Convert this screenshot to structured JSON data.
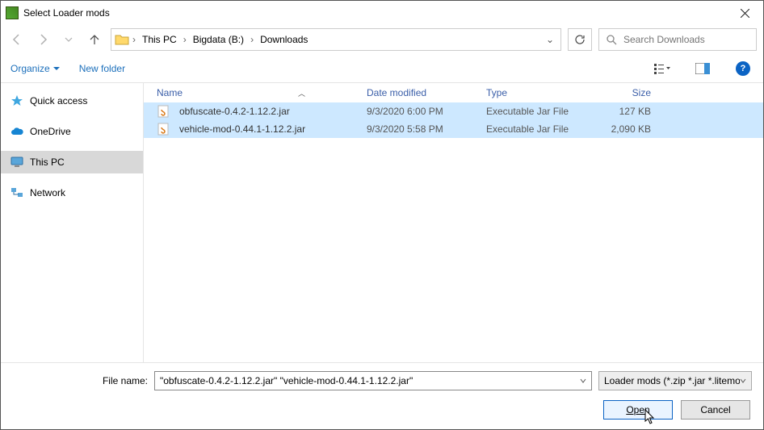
{
  "window": {
    "title": "Select Loader mods"
  },
  "breadcrumb": {
    "segments": [
      "This PC",
      "Bigdata (B:)",
      "Downloads"
    ]
  },
  "search": {
    "placeholder": "Search Downloads"
  },
  "toolbar": {
    "organize_label": "Organize",
    "newfolder_label": "New folder"
  },
  "sidebar": {
    "items": [
      {
        "label": "Quick access",
        "icon": "star"
      },
      {
        "label": "OneDrive",
        "icon": "cloud"
      },
      {
        "label": "This PC",
        "icon": "pc",
        "selected": true
      },
      {
        "label": "Network",
        "icon": "network"
      }
    ]
  },
  "columns": {
    "name": "Name",
    "date": "Date modified",
    "type": "Type",
    "size": "Size"
  },
  "files": [
    {
      "name": "obfuscate-0.4.2-1.12.2.jar",
      "date": "9/3/2020 6:00 PM",
      "type": "Executable Jar File",
      "size": "127 KB",
      "selected": true
    },
    {
      "name": "vehicle-mod-0.44.1-1.12.2.jar",
      "date": "9/3/2020 5:58 PM",
      "type": "Executable Jar File",
      "size": "2,090 KB",
      "selected": true
    }
  ],
  "footer": {
    "filename_label": "File name:",
    "filename_value": "\"obfuscate-0.4.2-1.12.2.jar\" \"vehicle-mod-0.44.1-1.12.2.jar\"",
    "filter_label": "Loader mods (*.zip *.jar *.litemo",
    "open_label": "Open",
    "cancel_label": "Cancel"
  }
}
